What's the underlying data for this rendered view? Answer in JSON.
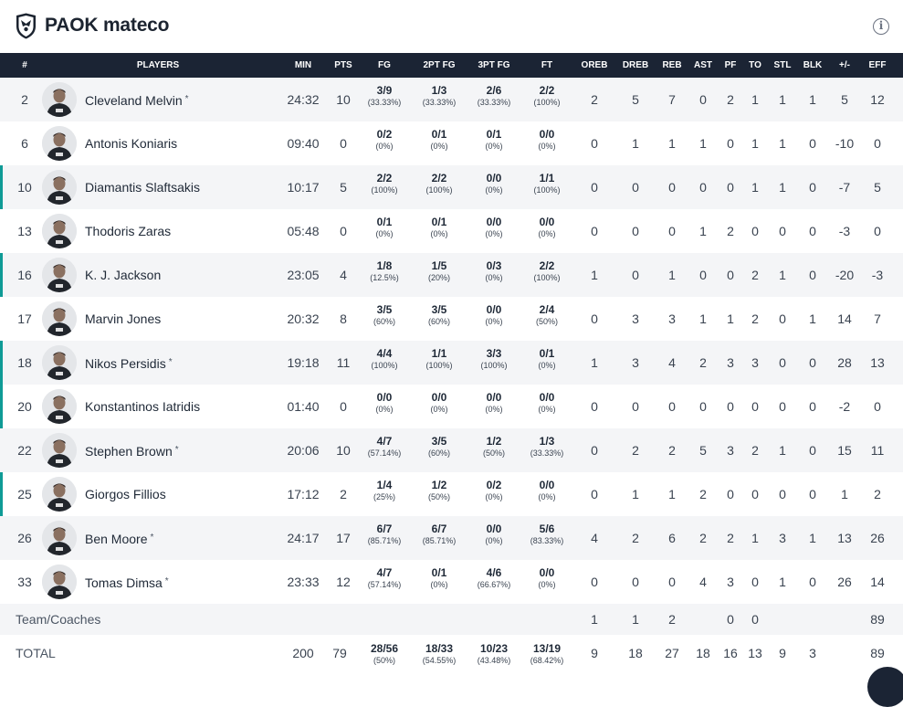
{
  "header": {
    "title": "PAOK mateco",
    "logo_icon": "paok-crest-icon",
    "info_icon": "info-icon"
  },
  "columns": [
    "#",
    "PLAYERS",
    "MIN",
    "PTS",
    "FG",
    "2PT FG",
    "3PT FG",
    "FT",
    "OREB",
    "DREB",
    "REB",
    "AST",
    "PF",
    "TO",
    "STL",
    "BLK",
    "+/-",
    "EFF"
  ],
  "colors": {
    "header_bg": "#1b2434",
    "accent": "#0f9b96",
    "row_alt": "#f4f5f7"
  },
  "players": [
    {
      "num": "2",
      "name": "Cleveland Melvin",
      "starter": true,
      "accent": false,
      "min": "24:32",
      "pts": "10",
      "fg": "3/9",
      "fg_pct": "(33.33%)",
      "fg2": "1/3",
      "fg2_pct": "(33.33%)",
      "fg3": "2/6",
      "fg3_pct": "(33.33%)",
      "ft": "2/2",
      "ft_pct": "(100%)",
      "oreb": "2",
      "dreb": "5",
      "reb": "7",
      "ast": "0",
      "pf": "2",
      "to": "1",
      "stl": "1",
      "blk": "1",
      "pm": "5",
      "eff": "12"
    },
    {
      "num": "6",
      "name": "Antonis Koniaris",
      "starter": false,
      "accent": false,
      "min": "09:40",
      "pts": "0",
      "fg": "0/2",
      "fg_pct": "(0%)",
      "fg2": "0/1",
      "fg2_pct": "(0%)",
      "fg3": "0/1",
      "fg3_pct": "(0%)",
      "ft": "0/0",
      "ft_pct": "(0%)",
      "oreb": "0",
      "dreb": "1",
      "reb": "1",
      "ast": "1",
      "pf": "0",
      "to": "1",
      "stl": "1",
      "blk": "0",
      "pm": "-10",
      "eff": "0"
    },
    {
      "num": "10",
      "name": "Diamantis Slaftsakis",
      "starter": false,
      "accent": true,
      "min": "10:17",
      "pts": "5",
      "fg": "2/2",
      "fg_pct": "(100%)",
      "fg2": "2/2",
      "fg2_pct": "(100%)",
      "fg3": "0/0",
      "fg3_pct": "(0%)",
      "ft": "1/1",
      "ft_pct": "(100%)",
      "oreb": "0",
      "dreb": "0",
      "reb": "0",
      "ast": "0",
      "pf": "0",
      "to": "1",
      "stl": "1",
      "blk": "0",
      "pm": "-7",
      "eff": "5"
    },
    {
      "num": "13",
      "name": "Thodoris Zaras",
      "starter": false,
      "accent": false,
      "min": "05:48",
      "pts": "0",
      "fg": "0/1",
      "fg_pct": "(0%)",
      "fg2": "0/1",
      "fg2_pct": "(0%)",
      "fg3": "0/0",
      "fg3_pct": "(0%)",
      "ft": "0/0",
      "ft_pct": "(0%)",
      "oreb": "0",
      "dreb": "0",
      "reb": "0",
      "ast": "1",
      "pf": "2",
      "to": "0",
      "stl": "0",
      "blk": "0",
      "pm": "-3",
      "eff": "0"
    },
    {
      "num": "16",
      "name": "K. J. Jackson",
      "starter": false,
      "accent": true,
      "min": "23:05",
      "pts": "4",
      "fg": "1/8",
      "fg_pct": "(12.5%)",
      "fg2": "1/5",
      "fg2_pct": "(20%)",
      "fg3": "0/3",
      "fg3_pct": "(0%)",
      "ft": "2/2",
      "ft_pct": "(100%)",
      "oreb": "1",
      "dreb": "0",
      "reb": "1",
      "ast": "0",
      "pf": "0",
      "to": "2",
      "stl": "1",
      "blk": "0",
      "pm": "-20",
      "eff": "-3"
    },
    {
      "num": "17",
      "name": "Marvin Jones",
      "starter": false,
      "accent": false,
      "min": "20:32",
      "pts": "8",
      "fg": "3/5",
      "fg_pct": "(60%)",
      "fg2": "3/5",
      "fg2_pct": "(60%)",
      "fg3": "0/0",
      "fg3_pct": "(0%)",
      "ft": "2/4",
      "ft_pct": "(50%)",
      "oreb": "0",
      "dreb": "3",
      "reb": "3",
      "ast": "1",
      "pf": "1",
      "to": "2",
      "stl": "0",
      "blk": "1",
      "pm": "14",
      "eff": "7"
    },
    {
      "num": "18",
      "name": "Nikos Persidis",
      "starter": true,
      "accent": true,
      "min": "19:18",
      "pts": "11",
      "fg": "4/4",
      "fg_pct": "(100%)",
      "fg2": "1/1",
      "fg2_pct": "(100%)",
      "fg3": "3/3",
      "fg3_pct": "(100%)",
      "ft": "0/1",
      "ft_pct": "(0%)",
      "oreb": "1",
      "dreb": "3",
      "reb": "4",
      "ast": "2",
      "pf": "3",
      "to": "3",
      "stl": "0",
      "blk": "0",
      "pm": "28",
      "eff": "13"
    },
    {
      "num": "20",
      "name": "Konstantinos Iatridis",
      "starter": false,
      "accent": true,
      "min": "01:40",
      "pts": "0",
      "fg": "0/0",
      "fg_pct": "(0%)",
      "fg2": "0/0",
      "fg2_pct": "(0%)",
      "fg3": "0/0",
      "fg3_pct": "(0%)",
      "ft": "0/0",
      "ft_pct": "(0%)",
      "oreb": "0",
      "dreb": "0",
      "reb": "0",
      "ast": "0",
      "pf": "0",
      "to": "0",
      "stl": "0",
      "blk": "0",
      "pm": "-2",
      "eff": "0"
    },
    {
      "num": "22",
      "name": "Stephen Brown",
      "starter": true,
      "accent": false,
      "min": "20:06",
      "pts": "10",
      "fg": "4/7",
      "fg_pct": "(57.14%)",
      "fg2": "3/5",
      "fg2_pct": "(60%)",
      "fg3": "1/2",
      "fg3_pct": "(50%)",
      "ft": "1/3",
      "ft_pct": "(33.33%)",
      "oreb": "0",
      "dreb": "2",
      "reb": "2",
      "ast": "5",
      "pf": "3",
      "to": "2",
      "stl": "1",
      "blk": "0",
      "pm": "15",
      "eff": "11"
    },
    {
      "num": "25",
      "name": "Giorgos Fillios",
      "starter": false,
      "accent": true,
      "min": "17:12",
      "pts": "2",
      "fg": "1/4",
      "fg_pct": "(25%)",
      "fg2": "1/2",
      "fg2_pct": "(50%)",
      "fg3": "0/2",
      "fg3_pct": "(0%)",
      "ft": "0/0",
      "ft_pct": "(0%)",
      "oreb": "0",
      "dreb": "1",
      "reb": "1",
      "ast": "2",
      "pf": "0",
      "to": "0",
      "stl": "0",
      "blk": "0",
      "pm": "1",
      "eff": "2"
    },
    {
      "num": "26",
      "name": "Ben Moore",
      "starter": true,
      "accent": false,
      "min": "24:17",
      "pts": "17",
      "fg": "6/7",
      "fg_pct": "(85.71%)",
      "fg2": "6/7",
      "fg2_pct": "(85.71%)",
      "fg3": "0/0",
      "fg3_pct": "(0%)",
      "ft": "5/6",
      "ft_pct": "(83.33%)",
      "oreb": "4",
      "dreb": "2",
      "reb": "6",
      "ast": "2",
      "pf": "2",
      "to": "1",
      "stl": "3",
      "blk": "1",
      "pm": "13",
      "eff": "26"
    },
    {
      "num": "33",
      "name": "Tomas Dimsa",
      "starter": true,
      "accent": false,
      "min": "23:33",
      "pts": "12",
      "fg": "4/7",
      "fg_pct": "(57.14%)",
      "fg2": "0/1",
      "fg2_pct": "(0%)",
      "fg3": "4/6",
      "fg3_pct": "(66.67%)",
      "ft": "0/0",
      "ft_pct": "(0%)",
      "oreb": "0",
      "dreb": "0",
      "reb": "0",
      "ast": "4",
      "pf": "3",
      "to": "0",
      "stl": "1",
      "blk": "0",
      "pm": "26",
      "eff": "14"
    }
  ],
  "team": {
    "label": "Team/Coaches",
    "oreb": "1",
    "dreb": "1",
    "reb": "2",
    "pf": "0",
    "to": "0",
    "eff": "89"
  },
  "total": {
    "label": "TOTAL",
    "min": "200",
    "pts": "79",
    "fg": "28/56",
    "fg_pct": "(50%)",
    "fg2": "18/33",
    "fg2_pct": "(54.55%)",
    "fg3": "10/23",
    "fg3_pct": "(43.48%)",
    "ft": "13/19",
    "ft_pct": "(68.42%)",
    "oreb": "9",
    "dreb": "18",
    "reb": "27",
    "ast": "18",
    "pf": "16",
    "to": "13",
    "stl": "9",
    "blk": "3",
    "eff": "89"
  }
}
